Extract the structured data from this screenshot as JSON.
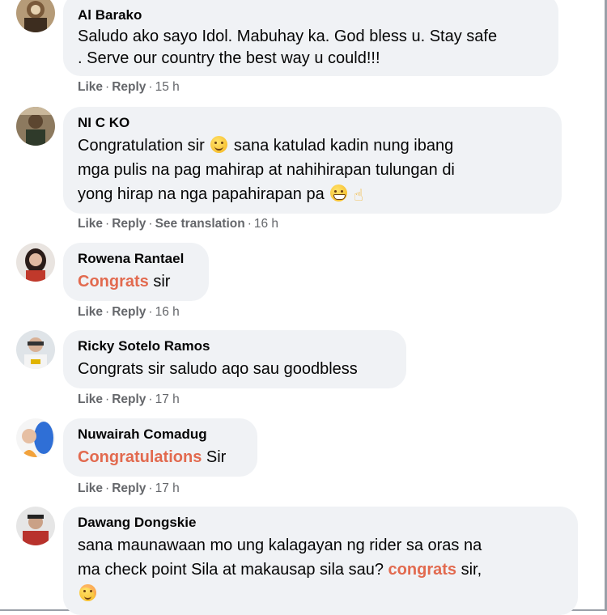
{
  "comments": [
    {
      "author": "Al Barako",
      "line1": "Saludo ako sayo Idol. Mabuhay ka. God bless u. Stay safe",
      "line2": ". Serve our country the best way u could!!!",
      "like": "Like",
      "reply": "Reply",
      "time": "15 h"
    },
    {
      "author": "NI C KO",
      "line1a": "Congratulation sir",
      "line1b": "sana katulad kadin nung ibang",
      "line2": "mga pulis na pag mahirap at nahihirapan tulungan di",
      "line3": "yong hirap na nga papahirapan pa",
      "like": "Like",
      "reply": "Reply",
      "translate": "See translation",
      "time": "16 h"
    },
    {
      "author": "Rowena Rantael",
      "highlight": "Congrats",
      "rest": " sir",
      "like": "Like",
      "reply": "Reply",
      "time": "16 h"
    },
    {
      "author": "Ricky Sotelo Ramos",
      "line1": "Congrats sir saludo aqo sau goodbless",
      "like": "Like",
      "reply": "Reply",
      "time": "17 h"
    },
    {
      "author": "Nuwairah Comadug",
      "highlight": "Congratulations",
      "rest": " Sir",
      "like": "Like",
      "reply": "Reply",
      "time": "17 h"
    },
    {
      "author": "Dawang Dongskie",
      "line1": "sana maunawaan mo ung kalagayan ng rider sa oras na",
      "line2a": "ma check point Sila at makausap sila sau? ",
      "highlight": "congrats",
      "line2b": " sir,"
    }
  ],
  "colors": {
    "bubble": "#f0f2f5",
    "highlight": "#e26a4f",
    "meta": "#65676b"
  },
  "icons": [
    "avatar",
    "smile-emoji",
    "grin-emoji",
    "hand-emoji",
    "relieved-emoji"
  ]
}
